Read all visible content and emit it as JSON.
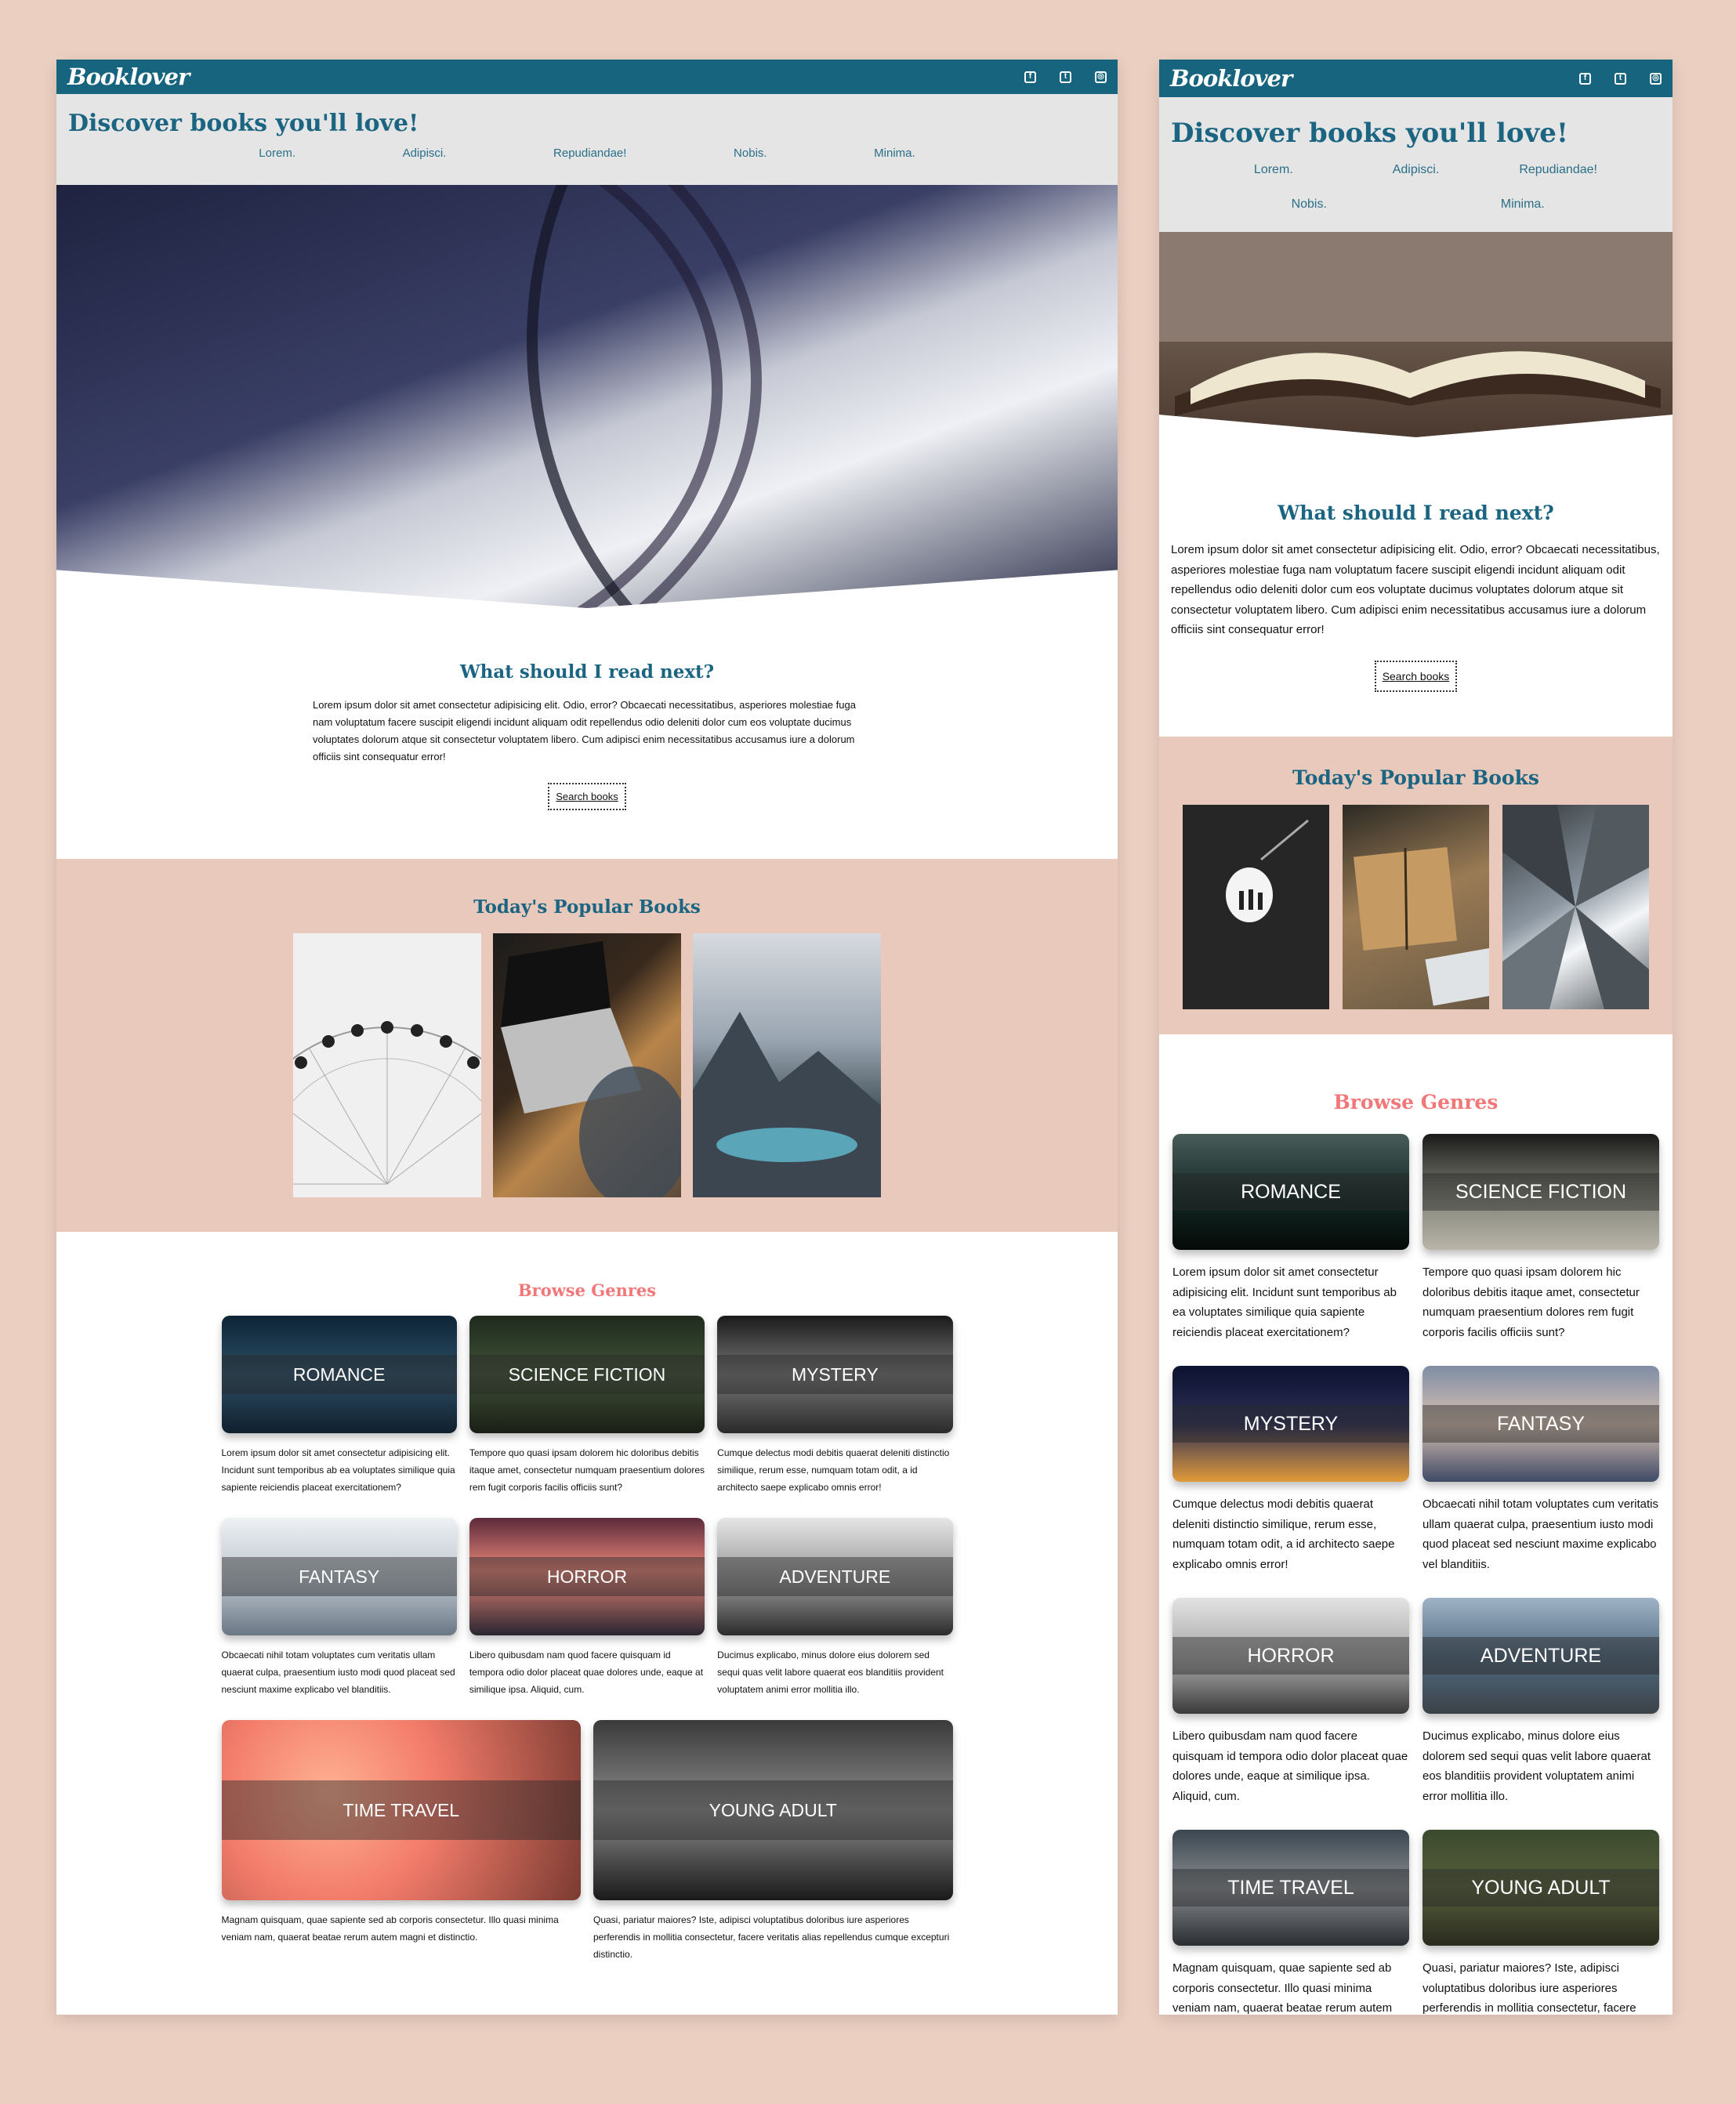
{
  "logo": "Booklover",
  "tagline": "Discover books you'll love!",
  "nav": [
    "Lorem.",
    "Adipisci.",
    "Repudiandae!",
    "Nobis.",
    "Minima."
  ],
  "socials": [
    "facebook-icon",
    "twitter-icon",
    "instagram-icon"
  ],
  "desktop": {
    "intro": {
      "title": "What should I read next?",
      "body": "Lorem ipsum dolor sit amet consectetur adipisicing elit. Odio, error? Obcaecati necessitatibus, asperiores molestiae fuga nam voluptatum facere suscipit eligendi incidunt aliquam odit repellendus odio deleniti dolor cum eos voluptate ducimus voluptates dolorum atque sit consectetur voluptatem libero. Cum adipisci enim necessitatibus accusamus iure a dolorum officiis sint consequatur error!",
      "button": "Search books"
    },
    "popular_title": "Today's Popular Books",
    "browse_title": "Browse Genres",
    "genres": [
      {
        "name": "Romance",
        "desc": "Lorem ipsum dolor sit amet consectetur adipisicing elit. Incidunt sunt temporibus ab ea voluptates similique quia sapiente reiciendis placeat exercitationem?"
      },
      {
        "name": "Science Fiction",
        "desc": "Tempore quo quasi ipsam dolorem hic doloribus debitis itaque amet, consectetur numquam praesentium dolores rem fugit corporis facilis officiis sunt?"
      },
      {
        "name": "Mystery",
        "desc": "Cumque delectus modi debitis quaerat deleniti distinctio similique, rerum esse, numquam totam odit, a id architecto saepe explicabo omnis error!"
      },
      {
        "name": "Fantasy",
        "desc": "Obcaecati nihil totam voluptates cum veritatis ullam quaerat culpa, praesentium iusto modi quod placeat sed nesciunt maxime explicabo vel blanditiis."
      },
      {
        "name": "Horror",
        "desc": "Libero quibusdam nam quod facere quisquam id tempora odio dolor placeat quae dolores unde, eaque at similique ipsa. Aliquid, cum."
      },
      {
        "name": "Adventure",
        "desc": "Ducimus explicabo, minus dolore eius dolorem sed sequi quas velit labore quaerat eos blanditiis provident voluptatem animi error mollitia illo."
      },
      {
        "name": "Time Travel",
        "desc": "Magnam quisquam, quae sapiente sed ab corporis consectetur. Illo quasi minima veniam nam, quaerat beatae rerum autem magni et distinctio."
      },
      {
        "name": "Young Adult",
        "desc": "Quasi, pariatur maiores? Iste, adipisci voluptatibus doloribus iure asperiores perferendis in mollitia consectetur, facere veritatis alias repellendus cumque excepturi distinctio."
      }
    ]
  },
  "mobile": {
    "intro": {
      "title": "What should I read next?",
      "body": "Lorem ipsum dolor sit amet consectetur adipisicing elit. Odio, error? Obcaecati necessitatibus, asperiores molestiae fuga nam voluptatum facere suscipit eligendi incidunt aliquam odit repellendus odio deleniti dolor cum eos voluptate ducimus voluptates dolorum atque sit consectetur voluptatem libero. Cum adipisci enim necessitatibus accusamus iure a dolorum officiis sint consequatur error!",
      "button": "Search books"
    },
    "popular_title": "Today's Popular Books",
    "browse_title": "Browse Genres",
    "genres": [
      {
        "name": "Romance",
        "desc": "Lorem ipsum dolor sit amet consectetur adipisicing elit. Incidunt sunt temporibus ab ea voluptates similique quia sapiente reiciendis placeat exercitationem?"
      },
      {
        "name": "Science Fiction",
        "desc": "Tempore quo quasi ipsam dolorem hic doloribus debitis itaque amet, consectetur numquam praesentium dolores rem fugit corporis facilis officiis sunt?"
      },
      {
        "name": "Mystery",
        "desc": "Cumque delectus modi debitis quaerat deleniti distinctio similique, rerum esse, numquam totam odit, a id architecto saepe explicabo omnis error!"
      },
      {
        "name": "Fantasy",
        "desc": "Obcaecati nihil totam voluptates cum veritatis ullam quaerat culpa, praesentium iusto modi quod placeat sed nesciunt maxime explicabo vel blanditiis."
      },
      {
        "name": "Horror",
        "desc": "Libero quibusdam nam quod facere quisquam id tempora odio dolor placeat quae dolores unde, eaque at similique ipsa. Aliquid, cum."
      },
      {
        "name": "Adventure",
        "desc": "Ducimus explicabo, minus dolore eius dolorem sed sequi quas velit labore quaerat eos blanditiis provident voluptatem animi error mollitia illo."
      },
      {
        "name": "Time Travel",
        "desc": "Magnam quisquam, quae sapiente sed ab corporis consectetur. Illo quasi minima veniam nam, quaerat beatae rerum autem magni et distinctio."
      },
      {
        "name": "Young Adult",
        "desc": "Quasi, pariatur maiores? Iste, adipisci voluptatibus doloribus iure asperiores perferendis in mollitia consectetur, facere veritatis alias repellendus cumque excepturi distinctio."
      }
    ]
  },
  "colors": {
    "topbar": "#17647f",
    "title": "#1b6582",
    "accent": "#f27779",
    "popular_bg": "#e8c9bb",
    "page_bg": "#ebcfc1"
  }
}
